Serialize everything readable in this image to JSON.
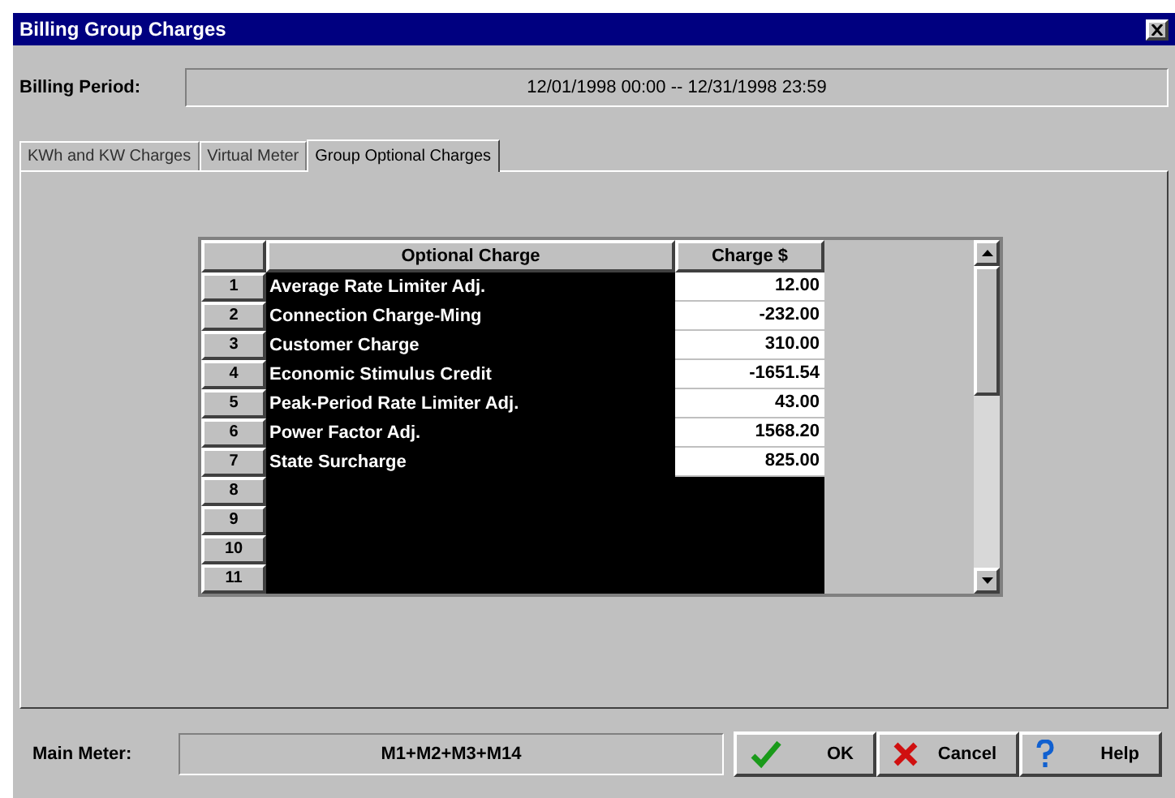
{
  "window": {
    "title": "Billing Group Charges"
  },
  "billing_period": {
    "label": "Billing Period:",
    "value": "12/01/1998 00:00 -- 12/31/1998 23:59"
  },
  "tabs": [
    {
      "label": "KWh and KW Charges",
      "selected": false
    },
    {
      "label": "Virtual Meter",
      "selected": false
    },
    {
      "label": "Group Optional Charges",
      "selected": true
    }
  ],
  "table": {
    "columns": [
      "Optional Charge",
      "Charge $"
    ],
    "rows": [
      {
        "number": "1",
        "name": "Average Rate Limiter Adj.",
        "charge": "12.00"
      },
      {
        "number": "2",
        "name": "Connection Charge-Ming",
        "charge": "-232.00"
      },
      {
        "number": "3",
        "name": "Customer Charge",
        "charge": "310.00"
      },
      {
        "number": "4",
        "name": "Economic Stimulus Credit",
        "charge": "-1651.54"
      },
      {
        "number": "5",
        "name": "Peak-Period Rate Limiter Adj.",
        "charge": "43.00"
      },
      {
        "number": "6",
        "name": "Power Factor Adj.",
        "charge": "1568.20"
      },
      {
        "number": "7",
        "name": "State Surcharge",
        "charge": "825.00"
      },
      {
        "number": "8"
      },
      {
        "number": "9"
      },
      {
        "number": "10"
      },
      {
        "number": "11"
      }
    ]
  },
  "main_meter": {
    "label": "Main Meter:",
    "value": "M1+M2+M3+M14"
  },
  "buttons": [
    {
      "kind": "ok",
      "label": "OK"
    },
    {
      "kind": "cancel",
      "label": "Cancel"
    },
    {
      "kind": "help",
      "label": "Help"
    }
  ]
}
